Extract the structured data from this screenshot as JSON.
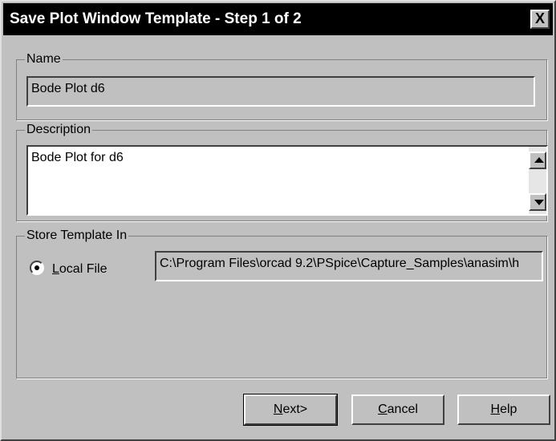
{
  "window": {
    "title": "Save Plot Window Template - Step 1 of 2",
    "close_label": "X"
  },
  "name_group": {
    "label": "Name",
    "value": "Bode Plot d6"
  },
  "description_group": {
    "label": "Description",
    "value": "Bode Plot for d6"
  },
  "store_group": {
    "label": "Store Template In",
    "option_label": "Local File",
    "option_mnemonic": "L",
    "option_rest": "ocal File",
    "option_selected": true,
    "path": "C:\\Program Files\\orcad 9.2\\PSpice\\Capture_Samples\\anasim\\h"
  },
  "buttons": {
    "next": {
      "mn": "N",
      "rest": "ext>"
    },
    "cancel": {
      "mn": "C",
      "rest": "ancel"
    },
    "help": {
      "mn": "H",
      "rest": "elp"
    }
  }
}
